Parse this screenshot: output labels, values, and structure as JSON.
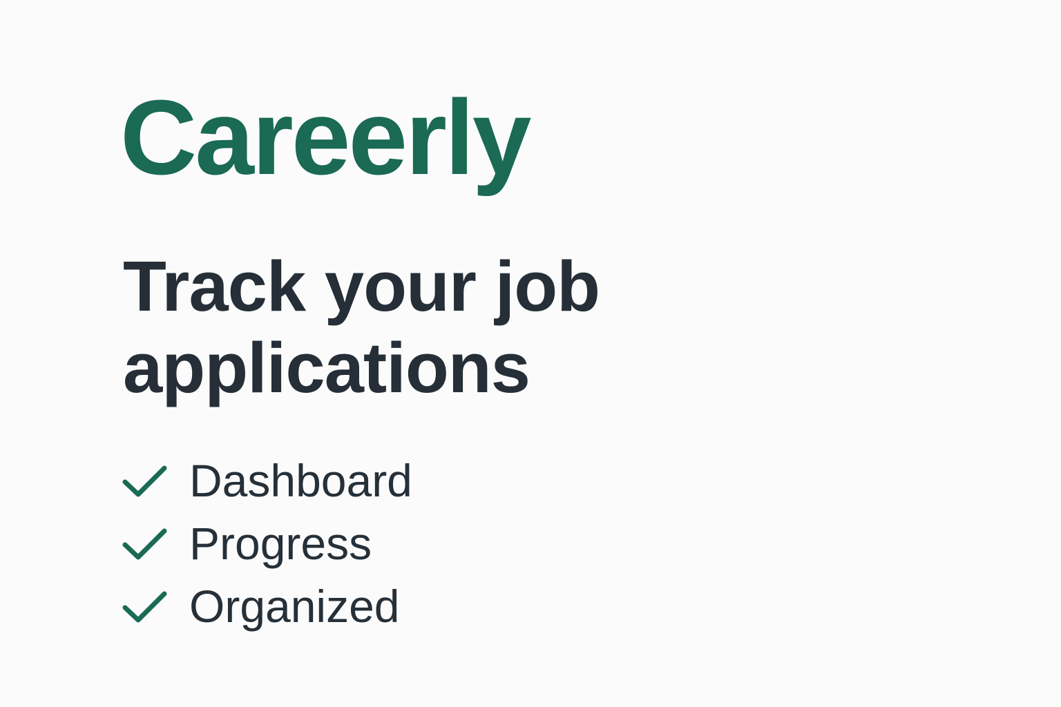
{
  "brand": {
    "name": "Careerly",
    "color": "#1a6a54"
  },
  "hero": {
    "headline": "Track your job applications"
  },
  "features": [
    {
      "label": "Dashboard",
      "icon": "checkmark-icon"
    },
    {
      "label": "Progress",
      "icon": "checkmark-icon"
    },
    {
      "label": "Organized",
      "icon": "checkmark-icon"
    }
  ],
  "colors": {
    "background": "#fbfbfb",
    "text": "#262f37",
    "accent": "#1a6a54"
  }
}
